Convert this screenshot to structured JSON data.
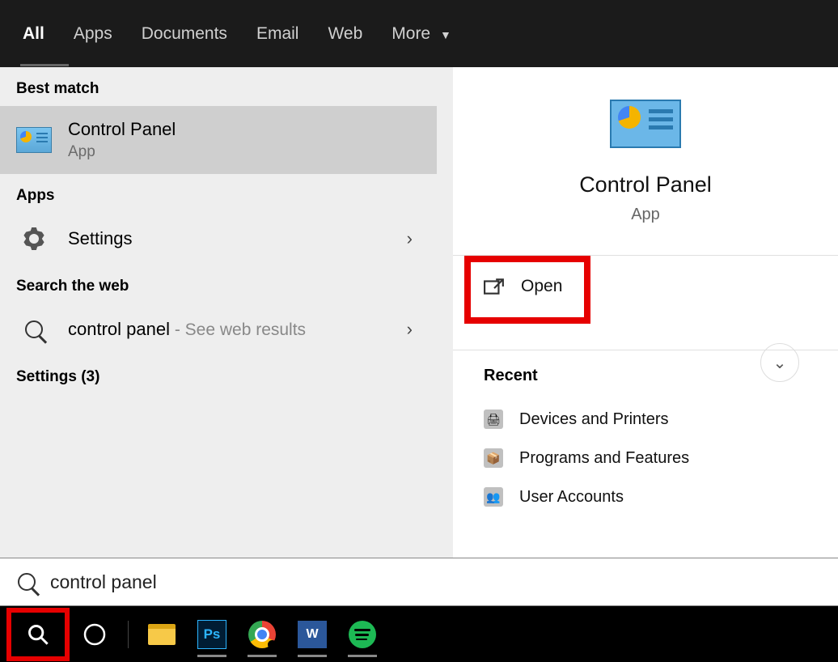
{
  "tabs": {
    "all": "All",
    "apps": "Apps",
    "documents": "Documents",
    "email": "Email",
    "web": "Web",
    "more": "More"
  },
  "left": {
    "best_match": "Best match",
    "result_title": "Control Panel",
    "result_subtitle": "App",
    "apps_header": "Apps",
    "settings_item": "Settings",
    "search_web_header": "Search the web",
    "web_query": "control panel",
    "web_tail": " - See web results",
    "settings_count": "Settings (3)"
  },
  "right": {
    "title": "Control Panel",
    "subtitle": "App",
    "open": "Open",
    "recent_header": "Recent",
    "recent_items": [
      "Devices and Printers",
      "Programs and Features",
      "User Accounts"
    ]
  },
  "search": {
    "value": "control panel"
  },
  "taskbar": {
    "icons": [
      "search-icon",
      "cortana-icon",
      "file-explorer-icon",
      "photoshop-icon",
      "chrome-icon",
      "word-icon",
      "spotify-icon"
    ]
  }
}
